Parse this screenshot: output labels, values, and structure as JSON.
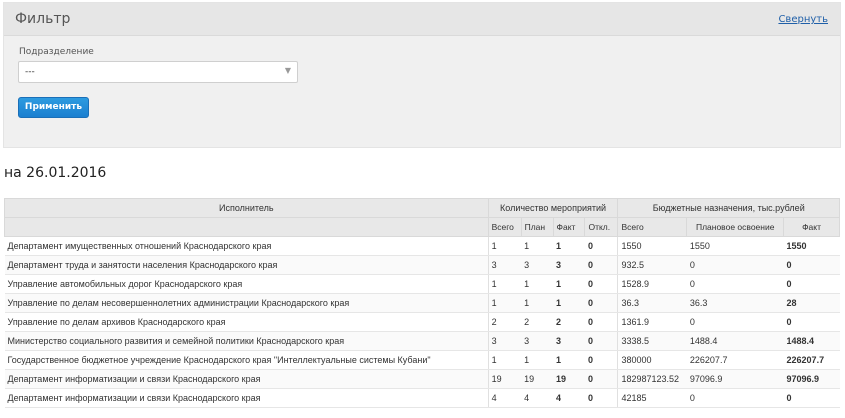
{
  "filter": {
    "title": "Фильтр",
    "collapse_label": "Свернуть",
    "subdivision_label": "Подразделение",
    "subdivision_value": "---",
    "apply_label": "Применить"
  },
  "report": {
    "date_label": "на 26.01.2016",
    "headers": {
      "executor": "Исполнитель",
      "events_group": "Количество мероприятий",
      "budget_group": "Бюджетные назначения, тыс.рублей",
      "total": "Всего",
      "plan": "План",
      "fact": "Факт",
      "deviation": "Откл.",
      "budget_total": "Всего",
      "planned": "Плановое освоение",
      "budget_fact": "Факт"
    },
    "rows": [
      {
        "name": "Департамент имущественных отношений Краснодарского края",
        "total": "1",
        "plan": "1",
        "fact": "1",
        "dev": "0",
        "b_total": "1550",
        "b_plan": "1550",
        "b_fact": "1550"
      },
      {
        "name": "Департамент труда и занятости населения Краснодарского края",
        "total": "3",
        "plan": "3",
        "fact": "3",
        "dev": "0",
        "b_total": "932.5",
        "b_plan": "0",
        "b_fact": "0"
      },
      {
        "name": "Управление автомобильных дорог Краснодарского края",
        "total": "1",
        "plan": "1",
        "fact": "1",
        "dev": "0",
        "b_total": "1528.9",
        "b_plan": "0",
        "b_fact": "0"
      },
      {
        "name": "Управление по делам несовершеннолетних администрации Краснодарского края",
        "total": "1",
        "plan": "1",
        "fact": "1",
        "dev": "0",
        "b_total": "36.3",
        "b_plan": "36.3",
        "b_fact": "28"
      },
      {
        "name": "Управление по делам архивов Краснодарского края",
        "total": "2",
        "plan": "2",
        "fact": "2",
        "dev": "0",
        "b_total": "1361.9",
        "b_plan": "0",
        "b_fact": "0"
      },
      {
        "name": "Министерство социального развития и семейной политики Краснодарского края",
        "total": "3",
        "plan": "3",
        "fact": "3",
        "dev": "0",
        "b_total": "3338.5",
        "b_plan": "1488.4",
        "b_fact": "1488.4"
      },
      {
        "name": "Государственное бюджетное учреждение Краснодарского края \"Интеллектуальные системы Кубани\"",
        "total": "1",
        "plan": "1",
        "fact": "1",
        "dev": "0",
        "b_total": "380000",
        "b_plan": "226207.7",
        "b_fact": "226207.7"
      },
      {
        "name": "Департамент информатизации и связи Краснодарского края",
        "total": "19",
        "plan": "19",
        "fact": "19",
        "dev": "0",
        "b_total": "182987123.52",
        "b_plan": "97096.9",
        "b_fact": "97096.9"
      },
      {
        "name": "Департамент информатизации и связи Краснодарского края",
        "total": "4",
        "plan": "4",
        "fact": "4",
        "dev": "0",
        "b_total": "42185",
        "b_plan": "0",
        "b_fact": "0"
      }
    ]
  },
  "colors": {
    "fact_green": "#2aa52a",
    "deviation_red": "#d9251b",
    "button_blue": "#1b7fd0"
  }
}
